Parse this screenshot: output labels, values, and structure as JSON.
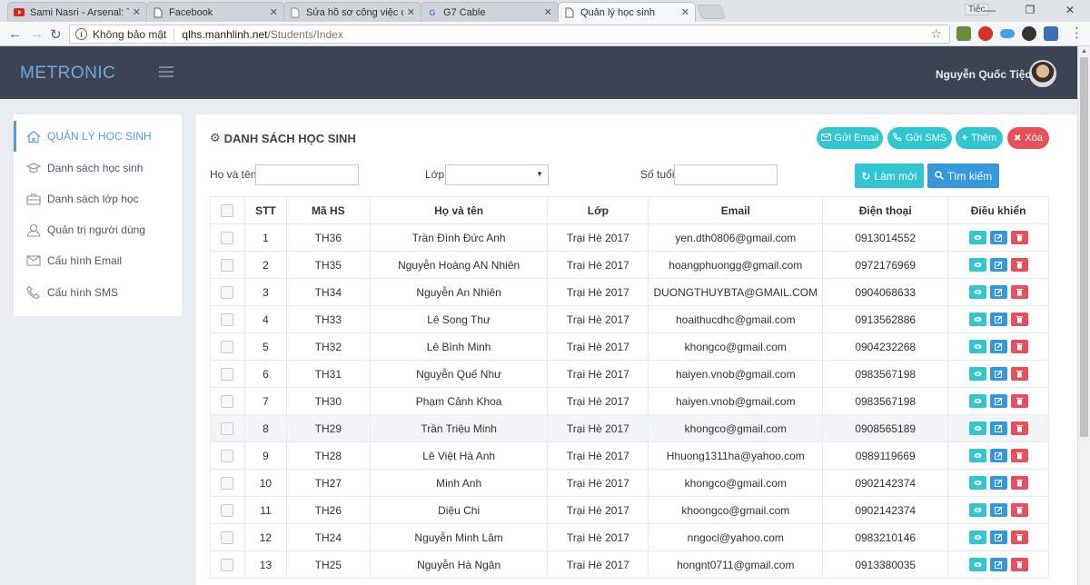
{
  "browser": {
    "tabs": [
      {
        "title": "Sami Nasri - Arsenal: Từ đ",
        "icon": "youtube-icon",
        "active": false
      },
      {
        "title": "Facebook",
        "icon": "page-icon",
        "active": false
      },
      {
        "title": "Sửa hồ sơ công việc của b",
        "icon": "page-icon",
        "active": false
      },
      {
        "title": "G7 Cable",
        "icon": "google-icon",
        "active": false
      },
      {
        "title": "Quản lý học sinh",
        "icon": "page-icon",
        "active": true
      }
    ],
    "profile": "Tiệc",
    "security_label": "Không bảo mật",
    "url_host": "qlhs.manhlinh.net",
    "url_path": "/Students/Index"
  },
  "header": {
    "logo": "METRONIC",
    "user_name": "Nguyễn Quốc Tiệc"
  },
  "sidebar": {
    "items": [
      {
        "label": "QUẢN LÝ HỌC SINH",
        "icon": "home-icon",
        "active": true
      },
      {
        "label": "Danh sách học sinh",
        "icon": "graduation-cap-icon",
        "active": false
      },
      {
        "label": "Danh sách lớp học",
        "icon": "briefcase-icon",
        "active": false
      },
      {
        "label": "Quản trị người dùng",
        "icon": "user-icon",
        "active": false
      },
      {
        "label": "Cấu hình Email",
        "icon": "envelope-icon",
        "active": false
      },
      {
        "label": "Cấu hình SMS",
        "icon": "phone-icon",
        "active": false
      }
    ]
  },
  "panel": {
    "title": "DANH SÁCH HỌC SINH",
    "buttons": {
      "send_email": "Gửi Email",
      "send_sms": "Gửi SMS",
      "add": "Thêm",
      "delete": "Xóa",
      "reset": "Làm mới",
      "search": "Tìm kiếm"
    },
    "filters": {
      "name_label": "Họ và tên",
      "class_label": "Lớp",
      "age_label": "Số tuổi"
    }
  },
  "table": {
    "columns": [
      "STT",
      "Mã HS",
      "Họ và tên",
      "Lớp",
      "Email",
      "Điện thoại",
      "Điều khiển"
    ],
    "rows": [
      [
        "1",
        "TH36",
        "Trần Đình Đức Anh",
        "Trại Hè 2017",
        "yen.dth0806@gmail.com",
        "0913014552"
      ],
      [
        "2",
        "TH35",
        "Nguyễn Hoàng AN Nhiên",
        "Trại Hè 2017",
        "hoangphuongg@gmail.com",
        "0972176969"
      ],
      [
        "3",
        "TH34",
        "Nguyễn An Nhiên",
        "Trại Hè 2017",
        "DUONGTHUYBTA@GMAIL.COM",
        "0904068633"
      ],
      [
        "4",
        "TH33",
        "Lê Song Thư",
        "Trại Hè 2017",
        "hoaithucdhc@gmail.com",
        "0913562886"
      ],
      [
        "5",
        "TH32",
        "Lê Bình Minh",
        "Trại Hè 2017",
        "khongco@gmail.com",
        "0904232268"
      ],
      [
        "6",
        "TH31",
        "Nguyễn Quế Như",
        "Trại Hè 2017",
        "haiyen.vnob@gmail.com",
        "0983567198"
      ],
      [
        "7",
        "TH30",
        "Phạm Cảnh Khoa",
        "Trại Hè 2017",
        "haiyen.vnob@gmail.com",
        "0983567198"
      ],
      [
        "8",
        "TH29",
        "Trần Triệu Minh",
        "Trại Hè 2017",
        "khongco@gmail.com",
        "0908565189"
      ],
      [
        "9",
        "TH28",
        "Lê Việt Hà Anh",
        "Trại Hè 2017",
        "Hhuong1311ha@yahoo.com",
        "0989119669"
      ],
      [
        "10",
        "TH27",
        "Minh Anh",
        "Trại Hè 2017",
        "khongco@gmail.com",
        "0902142374"
      ],
      [
        "11",
        "TH26",
        "Diệu Chi",
        "Trại Hè 2017",
        "khoongco@gmail.com",
        "0902142374"
      ],
      [
        "12",
        "TH24",
        "Nguyễn Minh Lâm",
        "Trại Hè 2017",
        "nngocl@yahoo.com",
        "0983210146"
      ],
      [
        "13",
        "TH25",
        "Nguyễn Hà Ngân",
        "Trại Hè 2017",
        "hongnt0711@gmail.com",
        "0913380035"
      ]
    ],
    "highlighted_row": 7
  },
  "colors": {
    "accent": "#5b9bd5",
    "teal": "#32c5d2",
    "red": "#e7505a",
    "blue": "#3598dc",
    "header_bg": "#3c4353"
  }
}
